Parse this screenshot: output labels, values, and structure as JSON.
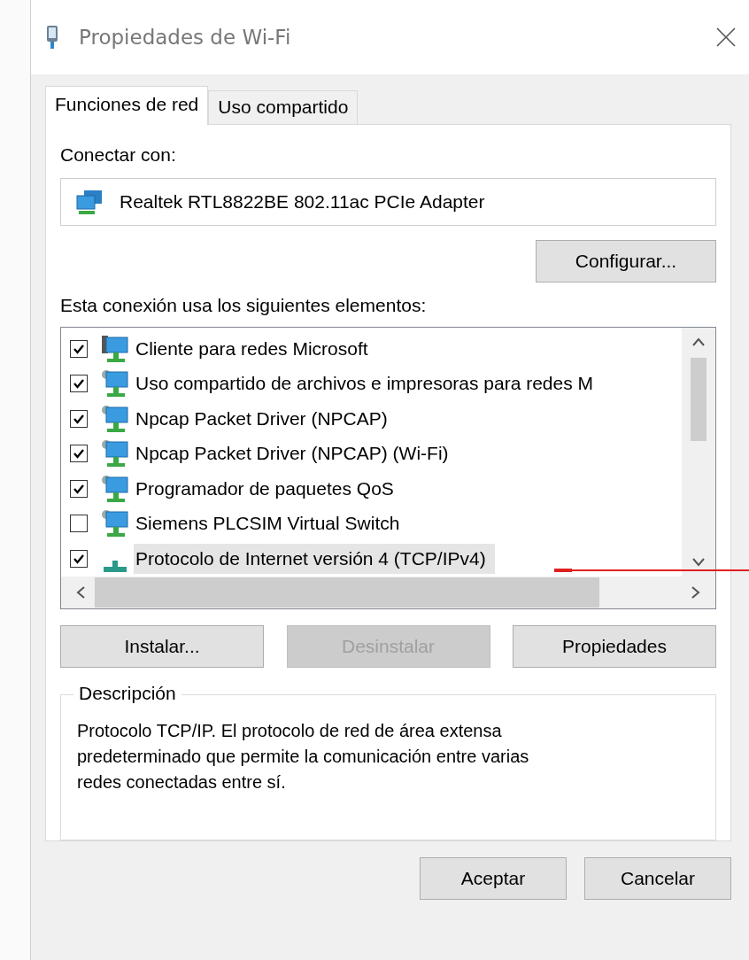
{
  "window": {
    "title": "Propiedades de Wi-Fi"
  },
  "tabs": [
    {
      "label": "Funciones de red",
      "selected": true
    },
    {
      "label": "Uso compartido",
      "selected": false
    }
  ],
  "connect_label": "Conectar con:",
  "adapter": "Realtek RTL8822BE 802.11ac PCIe Adapter",
  "configure_button": "Configurar...",
  "items_label": "Esta conexión usa los siguientes elementos:",
  "items": [
    {
      "label": "Cliente para redes Microsoft",
      "checked": true,
      "selected": false,
      "kind": "client"
    },
    {
      "label": "Uso compartido de archivos e impresoras para redes M",
      "checked": true,
      "selected": false,
      "kind": "service"
    },
    {
      "label": "Npcap Packet Driver (NPCAP)",
      "checked": true,
      "selected": false,
      "kind": "service"
    },
    {
      "label": "Npcap Packet Driver (NPCAP) (Wi-Fi)",
      "checked": true,
      "selected": false,
      "kind": "service"
    },
    {
      "label": "Programador de paquetes QoS",
      "checked": true,
      "selected": false,
      "kind": "service"
    },
    {
      "label": "Siemens PLCSIM Virtual Switch",
      "checked": false,
      "selected": false,
      "kind": "service"
    },
    {
      "label": "Protocolo de Internet versión 4 (TCP/IPv4)",
      "checked": true,
      "selected": true,
      "kind": "protocol"
    }
  ],
  "item_buttons": [
    {
      "label": "Instalar...",
      "disabled": false
    },
    {
      "label": "Desinstalar",
      "disabled": true
    },
    {
      "label": "Propiedades",
      "disabled": false
    }
  ],
  "description": {
    "title": "Descripción",
    "text": "Protocolo TCP/IP. El protocolo de red de área extensa predeterminado que permite la comunicación entre varias redes conectadas entre sí."
  },
  "buttons": [
    "Aceptar",
    "Cancelar"
  ]
}
